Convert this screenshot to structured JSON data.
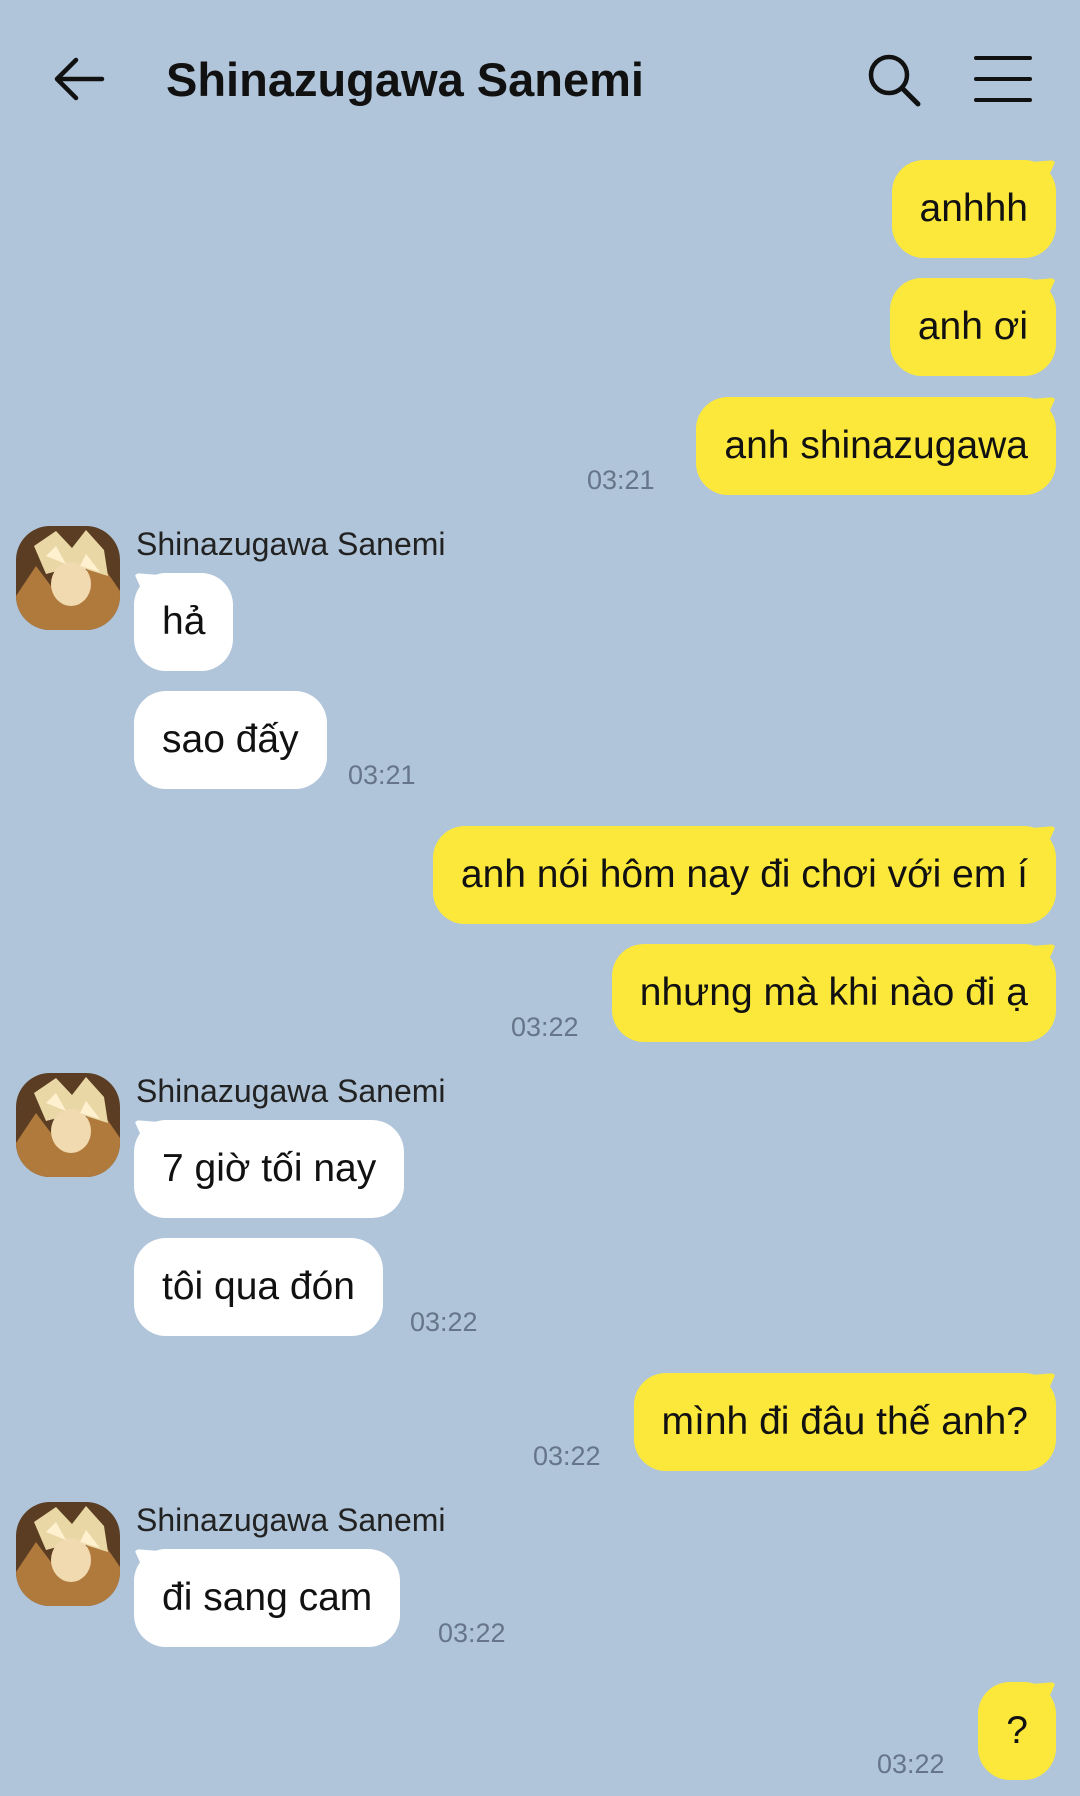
{
  "header": {
    "title": "Shinazugawa Sanemi",
    "back_icon": "arrow-left-icon",
    "search_icon": "search-icon",
    "menu_icon": "hamburger-menu-icon"
  },
  "colors": {
    "background": "#b0c5d9",
    "outgoing_bubble": "#fbe83b",
    "incoming_bubble": "#ffffff",
    "timestamp": "#66758a"
  },
  "contact": {
    "name": "Shinazugawa Sanemi"
  },
  "messages": {
    "m1": "anhhh",
    "m2": "anh ơi",
    "m3": "anh shinazugawa",
    "m4": "hả",
    "m5": "sao đấy",
    "m6": "anh nói hôm nay đi chơi với em í",
    "m7": "nhưng mà khi nào đi ạ",
    "m8": "7 giờ tối nay",
    "m9": "tôi qua đón",
    "m10": "mình đi đâu thế anh?",
    "m11": "đi sang cam",
    "m12": "?"
  },
  "times": {
    "t1": "03:21",
    "t2": "03:21",
    "t3": "03:22",
    "t4": "03:22",
    "t5": "03:22",
    "t6": "03:22",
    "t7": "03:22"
  }
}
